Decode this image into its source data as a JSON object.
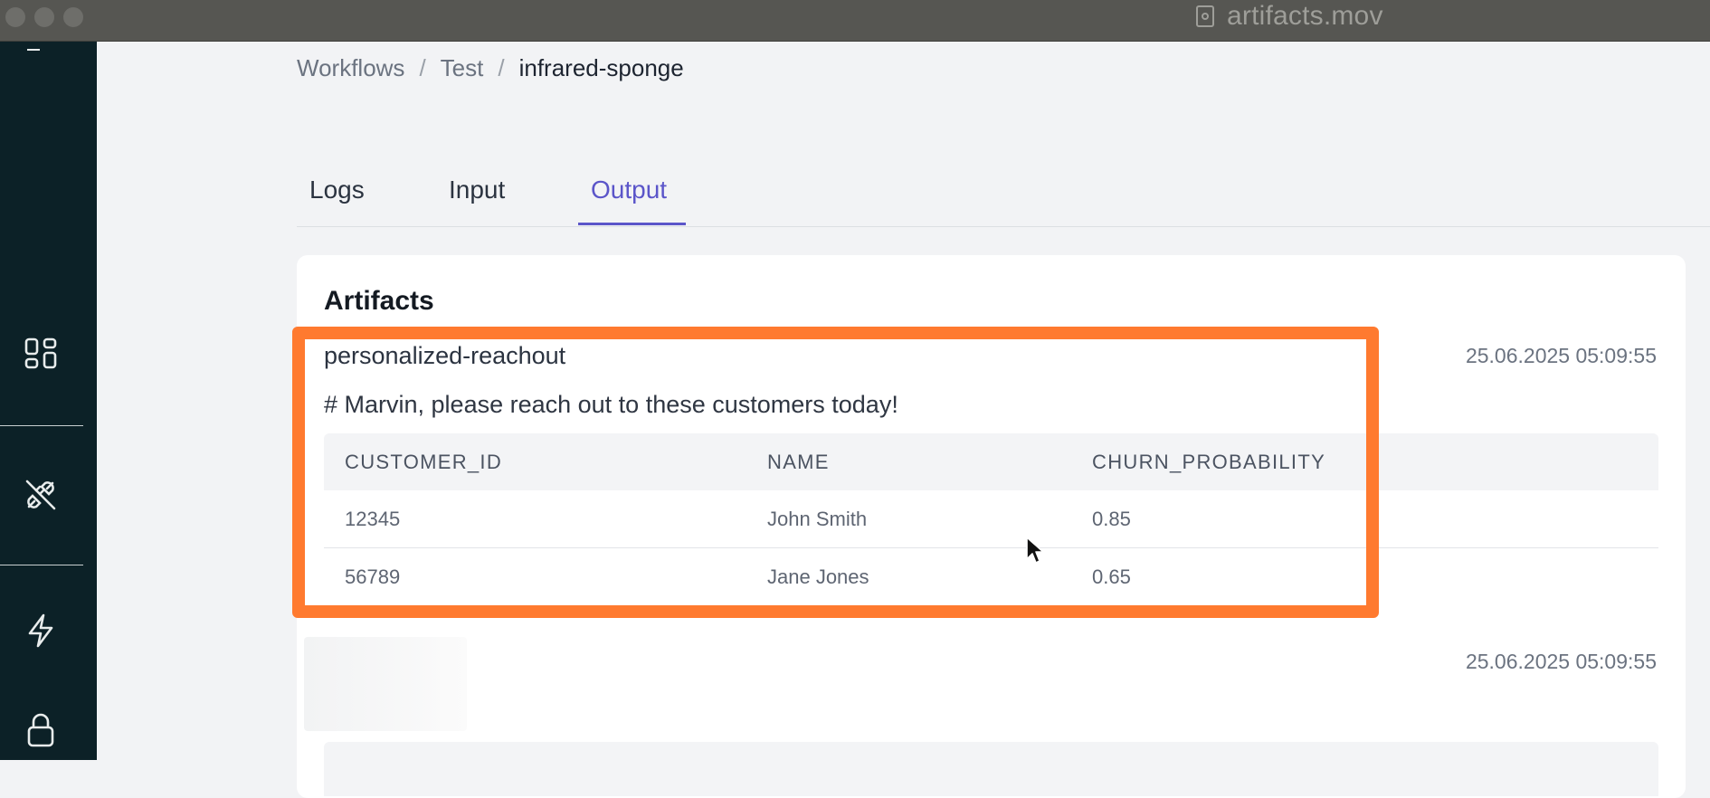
{
  "window": {
    "title": "artifacts.mov"
  },
  "sidebar": {
    "items": [
      {
        "icon": "dashboard-icon"
      },
      {
        "icon": "plug-disconnected-icon"
      },
      {
        "icon": "lightning-icon"
      },
      {
        "icon": "lock-icon"
      }
    ]
  },
  "breadcrumb": {
    "items": [
      "Workflows",
      "Test",
      "infrared-sponge"
    ],
    "separator": "/"
  },
  "tabs": [
    {
      "label": "Logs",
      "active": false
    },
    {
      "label": "Input",
      "active": false
    },
    {
      "label": "Output",
      "active": true
    }
  ],
  "artifacts": {
    "title": "Artifacts",
    "items": [
      {
        "name": "personalized-reachout",
        "timestamp": "25.06.2025 05:09:55",
        "description": "# Marvin, please reach out to these customers today!",
        "table": {
          "columns": [
            "CUSTOMER_ID",
            "NAME",
            "CHURN_PROBABILITY"
          ],
          "rows": [
            [
              "12345",
              "John Smith",
              "0.85"
            ],
            [
              "56789",
              "Jane Jones",
              "0.65"
            ]
          ]
        }
      },
      {
        "name": "",
        "timestamp": "25.06.2025 05:09:55"
      }
    ]
  },
  "colors": {
    "accent": "#5b55c9",
    "highlight": "#ff7a2f",
    "sidebar": "#0c2127"
  }
}
